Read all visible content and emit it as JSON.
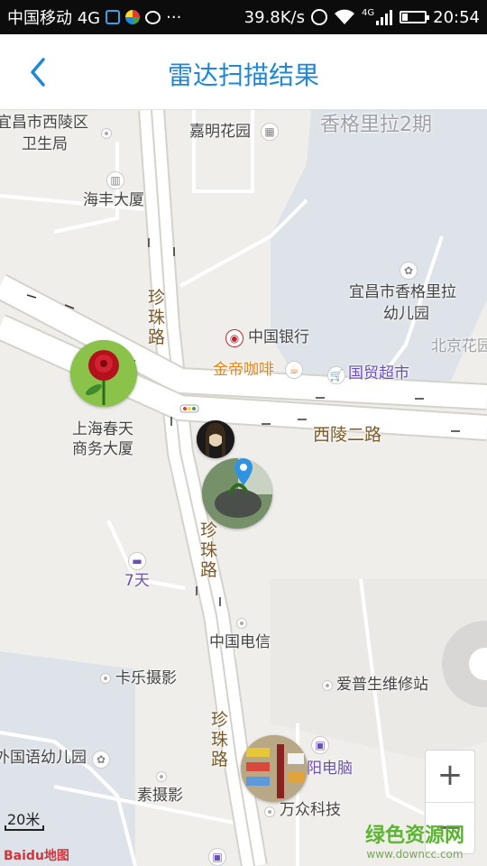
{
  "status_bar": {
    "carrier": "中国移动 4G",
    "more": "···",
    "speed": "39.8K/s",
    "network": "4G",
    "time": "20:54"
  },
  "header": {
    "title": "雷达扫描结果",
    "back_icon": "chevron-left-icon"
  },
  "map": {
    "labels": {
      "yichang_xiling_health": "宜昌市西陵区",
      "health_bureau": "卫生局",
      "jiaming": "嘉明花园",
      "shangri_la_2": "香格里拉2期",
      "haifeng": "海丰大厦",
      "shangri_kindergarten_1": "宜昌市香格里拉",
      "shangri_kindergarten_2": "幼儿园",
      "bank": "中国银行",
      "beijing_garden": "北京花园",
      "jindi_coffee": "金帝咖啡",
      "guomao": "国贸超市",
      "shanghai_spring_1": "上海春天",
      "shanghai_spring_2": "商务大厦",
      "xiling_road": "西陵二路",
      "seven_days": "7天",
      "china_telecom": "中国电信",
      "kale_photo": "卡乐摄影",
      "aipu_repair": "爱普生维修站",
      "foreign_kindergarten": "外国语幼儿园",
      "su_photo": "素摄影",
      "computer": "阳电脑",
      "wanzhong": "万众科技",
      "zhenzhu_1": "珍\n珠\n路",
      "zhenzhu_2": "珍\n珠\n路",
      "zhenzhu_3": "珍\n珠\n路"
    },
    "scale": "20米",
    "logo": "Baidu地图",
    "watermark_1": "绿色资源网",
    "watermark_2": "www.downcc.com",
    "zoom_in": "+",
    "zoom_out": "−"
  },
  "colors": {
    "accent": "#1e88d6",
    "status_bar": "#0c0c0c",
    "map_bg": "#efeeea",
    "road": "#ffffff",
    "block": "#dde3e9"
  }
}
